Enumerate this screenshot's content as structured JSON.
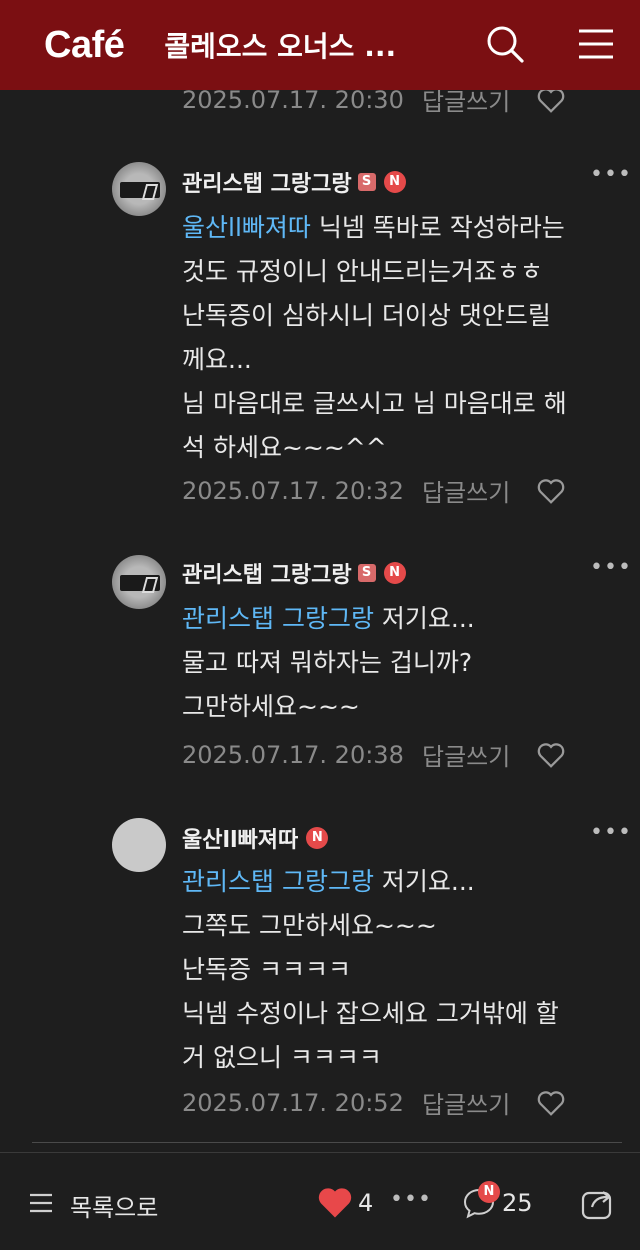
{
  "header": {
    "logo": "Café",
    "title": "콜레오스 오너스 ..."
  },
  "top_meta": {
    "date": "2025.07.17. 20:30",
    "reply": "답글쓰기"
  },
  "comments": [
    {
      "author": "관리스탭 그랑그랑",
      "badge_s": "S",
      "badge_n": "N",
      "mention": "울산ll빠져따",
      "lines": [
        "닉넴 똑바로 작성하라는",
        "것도 규정이니 안내드리는거죠ㅎㅎ",
        "난독증이 심하시니 더이상 댓안드릴",
        "께요...",
        "님 마음대로 글쓰시고 님 마음대로 해",
        "석 하세요~~~^^"
      ],
      "date": "2025.07.17. 20:32",
      "reply": "답글쓰기"
    },
    {
      "author": "관리스탭 그랑그랑",
      "badge_s": "S",
      "badge_n": "N",
      "mention": "관리스탭 그랑그랑",
      "lines": [
        "저기요...",
        "물고 따져 뭐하자는 겁니까?",
        "그만하세요~~~"
      ],
      "date": "2025.07.17. 20:38",
      "reply": "답글쓰기"
    },
    {
      "author": "울산ll빠져따",
      "badge_n": "N",
      "mention": "관리스탭 그랑그랑",
      "lines": [
        "저기요...",
        "그쪽도 그만하세요~~~",
        "난독증 ㅋㅋㅋㅋ",
        "닉넴 수정이나 잡으세요 그거밖에 할",
        "거 없으니 ㅋㅋㅋㅋ"
      ],
      "date": "2025.07.17. 20:52",
      "reply": "답글쓰기"
    }
  ],
  "bottom": {
    "list_label": "목록으로",
    "like_count": "4",
    "comment_badge": "N",
    "comment_count": "25"
  },
  "colors": {
    "header_bg": "#7b0f12",
    "mention": "#5fb8f6",
    "like": "#e8484a"
  }
}
